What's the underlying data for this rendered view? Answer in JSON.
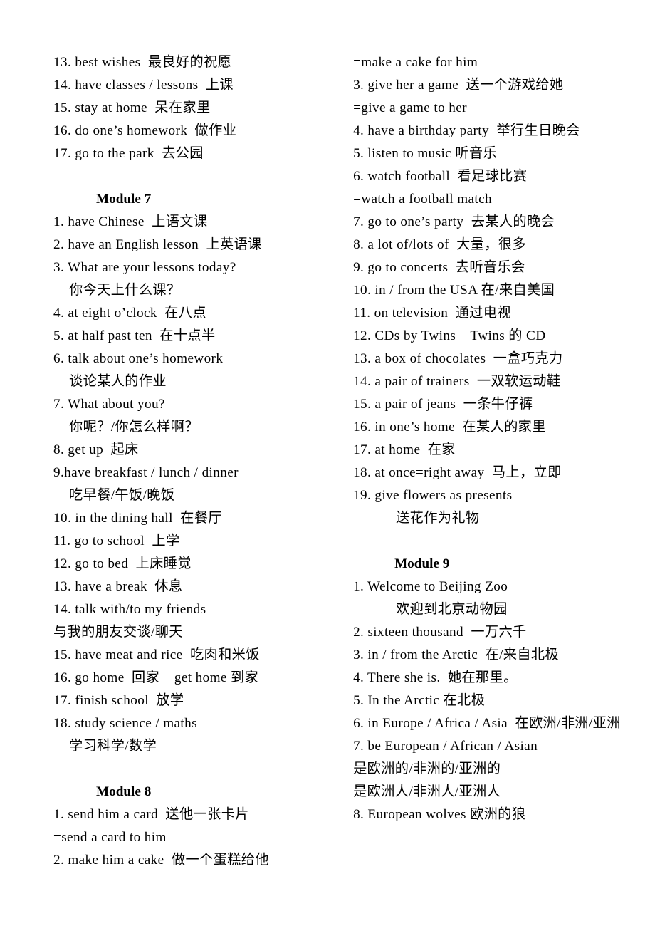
{
  "document": {
    "type": "vocabulary-phrase-list",
    "language_pair": "English-Chinese"
  },
  "left_column": {
    "blocks": [
      {
        "kind": "entries",
        "items": [
          {
            "text": "13. best wishes  最良好的祝愿",
            "indent": 0
          },
          {
            "text": "14. have classes / lessons  上课",
            "indent": 0
          },
          {
            "text": "15. stay at home  呆在家里",
            "indent": 0
          },
          {
            "text": "16. do one’s homework  做作业",
            "indent": 0
          },
          {
            "text": "17. go to the park  去公园",
            "indent": 0
          }
        ]
      },
      {
        "kind": "spacer"
      },
      {
        "kind": "heading",
        "text": "Module 7"
      },
      {
        "kind": "entries",
        "items": [
          {
            "text": "1. have Chinese  上语文课",
            "indent": 0
          },
          {
            "text": "2. have an English lesson  上英语课",
            "indent": 0
          },
          {
            "text": "3. What are your lessons today?",
            "indent": 0
          },
          {
            "text": "你今天上什么课？",
            "indent": 1
          },
          {
            "text": "4. at eight o’clock  在八点",
            "indent": 0
          },
          {
            "text": "5. at half past ten  在十点半",
            "indent": 0
          },
          {
            "text": "6. talk about one’s homework",
            "indent": 0
          },
          {
            "text": "谈论某人的作业",
            "indent": 1
          },
          {
            "text": "7. What about you?",
            "indent": 0
          },
          {
            "text": "你呢？/你怎么样啊？",
            "indent": 1
          },
          {
            "text": "8. get up  起床",
            "indent": 0
          },
          {
            "text": "9.have breakfast / lunch / dinner",
            "indent": 0
          },
          {
            "text": "吃早餐/午饭/晚饭",
            "indent": 1
          },
          {
            "text": "10. in the dining hall  在餐厅",
            "indent": 0
          },
          {
            "text": "11. go to school  上学",
            "indent": 0
          },
          {
            "text": "12. go to bed  上床睡觉",
            "indent": 0
          },
          {
            "text": "13. have a break  休息",
            "indent": 0
          },
          {
            "text": "14. talk with/to my friends",
            "indent": 0
          },
          {
            "text": "与我的朋友交谈/聊天",
            "indent": 0
          },
          {
            "text": "15. have meat and rice  吃肉和米饭",
            "indent": 0
          },
          {
            "text": "16. go home  回家    get home 到家",
            "indent": 0
          },
          {
            "text": "17. finish school  放学",
            "indent": 0
          },
          {
            "text": "18. study science / maths",
            "indent": 0
          },
          {
            "text": "学习科学/数学",
            "indent": 1
          }
        ]
      },
      {
        "kind": "spacer"
      },
      {
        "kind": "heading",
        "text": "Module 8"
      },
      {
        "kind": "entries",
        "items": [
          {
            "text": "1. send him a card  送他一张卡片",
            "indent": 0
          },
          {
            "text": "=send a card to him",
            "indent": 0
          },
          {
            "text": "2. make him a cake  做一个蛋糕给他",
            "indent": 0
          }
        ]
      }
    ]
  },
  "right_column": {
    "blocks": [
      {
        "kind": "entries",
        "items": [
          {
            "text": "=make a cake for him",
            "indent": 0
          },
          {
            "text": "3. give her a game  送一个游戏给她",
            "indent": 0
          },
          {
            "text": "=give a game to her",
            "indent": 0
          },
          {
            "text": "4. have a birthday party  举行生日晚会",
            "indent": 0
          },
          {
            "text": "5. listen to music 听音乐",
            "indent": 0
          },
          {
            "text": "6. watch football  看足球比赛",
            "indent": 0
          },
          {
            "text": "=watch a football match",
            "indent": 0
          },
          {
            "text": "7. go to one’s party  去某人的晚会",
            "indent": 0
          },
          {
            "text": "8. a lot of/lots of  大量，很多",
            "indent": 0
          },
          {
            "text": "9. go to concerts  去听音乐会",
            "indent": 0
          },
          {
            "text": "10. in / from the USA 在/来自美国",
            "indent": 0
          },
          {
            "text": "11. on television  通过电视",
            "indent": 0
          },
          {
            "text": "12. CDs by Twins    Twins 的 CD",
            "indent": 0
          },
          {
            "text": "13. a box of chocolates  一盒巧克力",
            "indent": 0
          },
          {
            "text": "14. a pair of trainers  一双软运动鞋",
            "indent": 0
          },
          {
            "text": "15. a pair of jeans  一条牛仔裤",
            "indent": 0
          },
          {
            "text": "16. in one’s home  在某人的家里",
            "indent": 0
          },
          {
            "text": "17. at home  在家",
            "indent": 0
          },
          {
            "text": "18. at once=right away  马上，立即",
            "indent": 0
          },
          {
            "text": "19. give flowers as presents",
            "indent": 0
          },
          {
            "text": "送花作为礼物",
            "indent": 2
          }
        ]
      },
      {
        "kind": "spacer"
      },
      {
        "kind": "heading",
        "text": "Module 9"
      },
      {
        "kind": "entries",
        "items": [
          {
            "text": "1. Welcome to Beijing Zoo",
            "indent": 0
          },
          {
            "text": "欢迎到北京动物园",
            "indent": 2
          },
          {
            "text": "2. sixteen thousand  一万六千",
            "indent": 0
          },
          {
            "text": "3. in / from the Arctic  在/来自北极",
            "indent": 0
          },
          {
            "text": "4. There she is.  她在那里。",
            "indent": 0
          },
          {
            "text": "5. In the Arctic 在北极",
            "indent": 0
          },
          {
            "text": "6. in Europe / Africa / Asia  在欧洲/非洲/亚洲",
            "indent": 0
          },
          {
            "text": "7. be European / African / Asian",
            "indent": 0
          },
          {
            "text": "是欧洲的/非洲的/亚洲的",
            "indent": 0
          },
          {
            "text": "是欧洲人/非洲人/亚洲人",
            "indent": 0
          },
          {
            "text": "8. European wolves 欧洲的狼",
            "indent": 0
          }
        ]
      }
    ]
  }
}
